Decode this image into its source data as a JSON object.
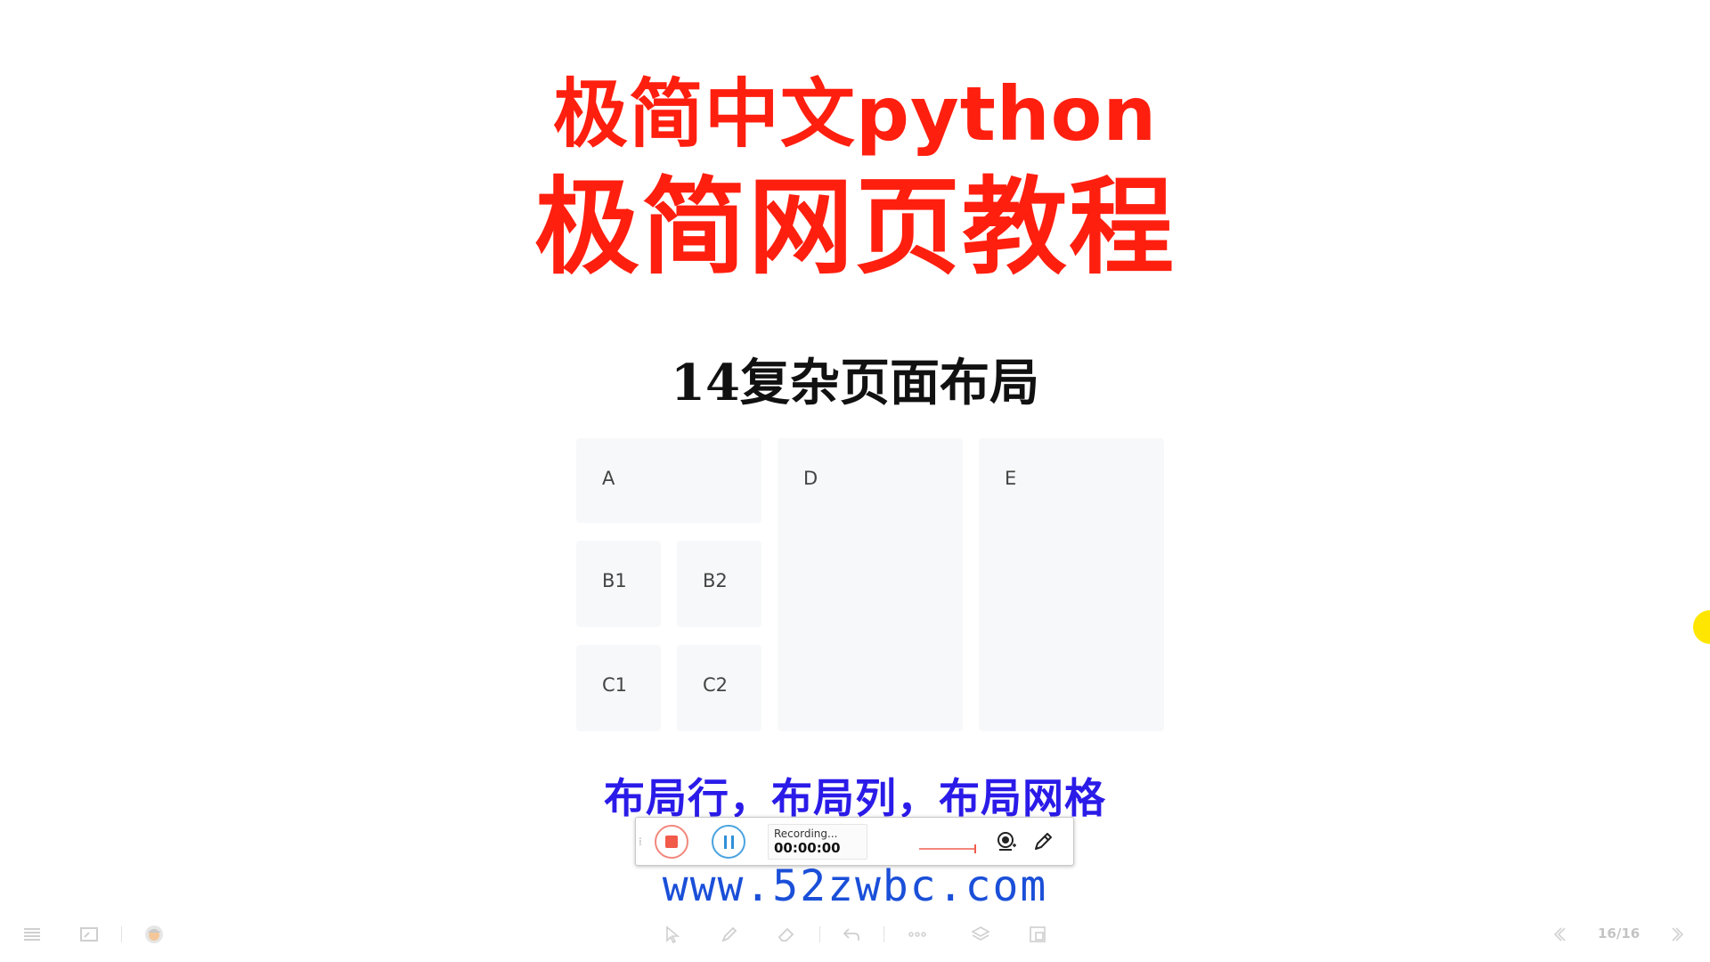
{
  "slide": {
    "title_line1": "极简中文python",
    "title_line2": "极简网页教程",
    "subtitle": "14复杂页面布局",
    "grid": {
      "a": "A",
      "b1": "B1",
      "b2": "B2",
      "c1": "C1",
      "c2": "C2",
      "d": "D",
      "e": "E"
    },
    "caption": "布局行，布局列，布局网格",
    "url": "www.52zwbc.com"
  },
  "recorder": {
    "status_label": "Recording...",
    "timer": "00:00:00",
    "icons": [
      "grip-icon",
      "stop-icon",
      "pause-icon",
      "webcam-icon",
      "pen-icon"
    ]
  },
  "bottom_toolbar": {
    "page_indicator": "16/16",
    "icons": [
      "menu-icon",
      "slide-thumbnail-icon",
      "avatar",
      "pointer-icon",
      "pen-icon",
      "eraser-icon",
      "undo-icon",
      "more-icon",
      "layers-icon",
      "window-icon",
      "prev-icon",
      "next-icon"
    ]
  },
  "colors": {
    "title": "#ff1f0f",
    "caption": "#2b1be8",
    "url": "#1a4fd8",
    "cell_bg": "#f7f8f9",
    "cursor_highlight": "#ffe600"
  }
}
